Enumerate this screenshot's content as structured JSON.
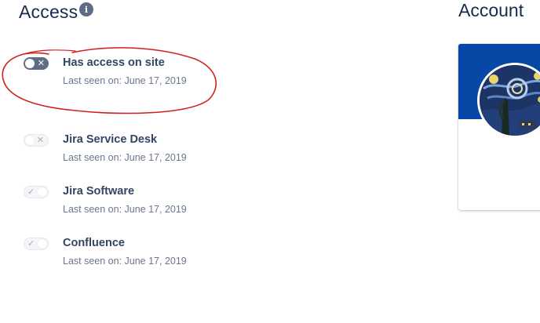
{
  "access": {
    "title": "Access",
    "info_glyph": "i",
    "rows": [
      {
        "label": "Has access on site",
        "sub": "Last seen on: June 17, 2019",
        "toggle": "off",
        "glyph": "✕"
      },
      {
        "label": "Jira Service Desk",
        "sub": "Last seen on: June 17, 2019",
        "toggle": "off",
        "glyph": "✕"
      },
      {
        "label": "Jira Software",
        "sub": "Last seen on: June 17, 2019",
        "toggle": "on",
        "glyph": "✓"
      },
      {
        "label": "Confluence",
        "sub": "Last seen on: June 17, 2019",
        "toggle": "on",
        "glyph": "✓"
      }
    ]
  },
  "account": {
    "title": "Account",
    "avatar_icon": "user-avatar-starry-night"
  },
  "colors": {
    "brand_blue": "#0747A6",
    "annotation_red": "#D0201E",
    "text_primary": "#172B4D",
    "text_secondary": "#6B778C"
  }
}
